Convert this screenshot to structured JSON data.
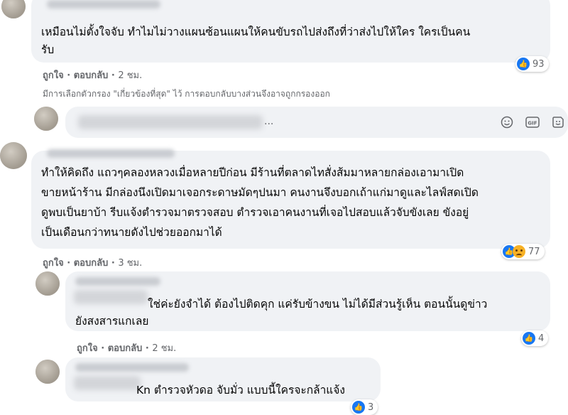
{
  "comments": [
    {
      "text_lines": [
        "เหมือนไม่ตั้งใจจับ ทำไมไม่วางแผนซ้อนแผนให้คนขับรถไปส่งถึงที่ว่าส่งไปให้ใคร ใครเป็นคน",
        "รับ"
      ],
      "like_label": "ถูกใจ",
      "reply_label": "ตอบกลับ",
      "time": "2 ชม.",
      "reaction_count": "93"
    },
    {
      "text_lines": [
        "ทำให้คิดถึง แถวๆคลองหลวงเมื่อหลายปีก่อน มีร้านที่ตลาดไทสั่งส้มมาหลายกล่องเอามาเปิด",
        "ขายหน้าร้าน มีกล่องนึงเปิดมาเจอกระดาษมัดๆปนมา คนงานจึงบอกเถ้าแก่มาดูและไลฟ์สดเปิด",
        "ดูพบเป็นยาบ้า รีบแจ้งตำรวจมาตรวจสอบ ตำรวจเอาคนงานที่เจอไปสอบแล้วจับขังเลย ขังอยู่",
        "เป็นเดือนกว่าทนายดังไปช่วยออกมาได้"
      ],
      "like_label": "ถูกใจ",
      "reply_label": "ตอบกลับ",
      "time": "3 ชม.",
      "reaction_count": "77"
    },
    {
      "text_lines": [
        "ใช่ค่ะยังจำได้ ต้องไปติดคุก แค่รับข้างขน ไม่ได้มีส่วนรู้เห็น ตอนนั้นดูข่าว",
        "ยังสงสารแกเลย"
      ],
      "like_label": "ถูกใจ",
      "reply_label": "ตอบกลับ",
      "time": "2 ชม.",
      "reaction_count": "4"
    },
    {
      "text_lines": [
        "Kn ตำรวจหัวดอ จับมั่ว แบบนี้ใครจะกล้าแจ้ง"
      ],
      "reaction_count": "3"
    }
  ],
  "filter_note": "มีการเลือกตัวกรอง \"เกี่ยวข้องที่สุด\" ไว้ การตอบกลับบางส่วนจึงอาจถูกกรองออก",
  "input_ellipsis": "...",
  "colors": {
    "bubble": "#f0f2f5",
    "meta": "#65676b",
    "like": "#1877f2"
  }
}
